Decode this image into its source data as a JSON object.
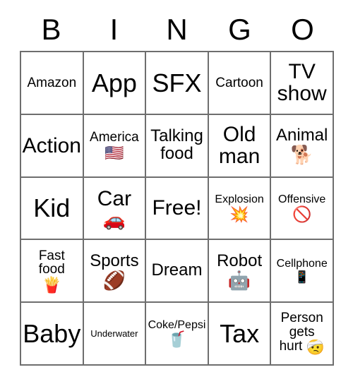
{
  "card": {
    "title": "BINGO",
    "header_letters": [
      "B",
      "I",
      "N",
      "G",
      "O"
    ],
    "grid_line_color": "#6e6e6e",
    "background_color": "#ffffff",
    "text_color": "#000000",
    "rows": 5,
    "columns": 5,
    "cells": [
      [
        {
          "label": "Amazon",
          "emoji": "",
          "emoji_name": ""
        },
        {
          "label": "App",
          "emoji": "",
          "emoji_name": ""
        },
        {
          "label": "SFX",
          "emoji": "",
          "emoji_name": ""
        },
        {
          "label": "Cartoon",
          "emoji": "",
          "emoji_name": ""
        },
        {
          "label": "TV\nshow",
          "emoji": "",
          "emoji_name": ""
        }
      ],
      [
        {
          "label": "Action",
          "emoji": "",
          "emoji_name": ""
        },
        {
          "label": "America",
          "emoji": "🇺🇸",
          "emoji_name": "flag-united-states-emoji"
        },
        {
          "label": "Talking\nfood",
          "emoji": "",
          "emoji_name": ""
        },
        {
          "label": "Old\nman",
          "emoji": "",
          "emoji_name": ""
        },
        {
          "label": "Animal",
          "emoji": "🐕",
          "emoji_name": "dog-emoji"
        }
      ],
      [
        {
          "label": "Kid",
          "emoji": "",
          "emoji_name": ""
        },
        {
          "label": "Car",
          "emoji": "🚗",
          "emoji_name": "car-emoji"
        },
        {
          "label": "Free!",
          "emoji": "",
          "emoji_name": ""
        },
        {
          "label": "Explosion",
          "emoji": "💥",
          "emoji_name": "explosion-emoji"
        },
        {
          "label": "Offensive",
          "emoji": "🚫",
          "emoji_name": "prohibited-emoji"
        }
      ],
      [
        {
          "label": "Fast\nfood",
          "emoji": "🍟",
          "emoji_name": "french-fries-emoji"
        },
        {
          "label": "Sports",
          "emoji": "🏈",
          "emoji_name": "american-football-emoji"
        },
        {
          "label": "Dream",
          "emoji": "",
          "emoji_name": ""
        },
        {
          "label": "Robot",
          "emoji": "🤖",
          "emoji_name": "robot-emoji"
        },
        {
          "label": "Cellphone",
          "emoji": "📱",
          "emoji_name": "mobile-phone-emoji"
        }
      ],
      [
        {
          "label": "Baby",
          "emoji": "",
          "emoji_name": ""
        },
        {
          "label": "Underwater",
          "emoji": "",
          "emoji_name": ""
        },
        {
          "label": "Coke/Pepsi",
          "emoji": "🥤",
          "emoji_name": "cup-with-straw-emoji"
        },
        {
          "label": "Tax",
          "emoji": "",
          "emoji_name": ""
        },
        {
          "label": "Person\ngets\nhurt ",
          "emoji": "🤕",
          "emoji_name": "face-with-head-bandage-emoji"
        }
      ]
    ]
  }
}
